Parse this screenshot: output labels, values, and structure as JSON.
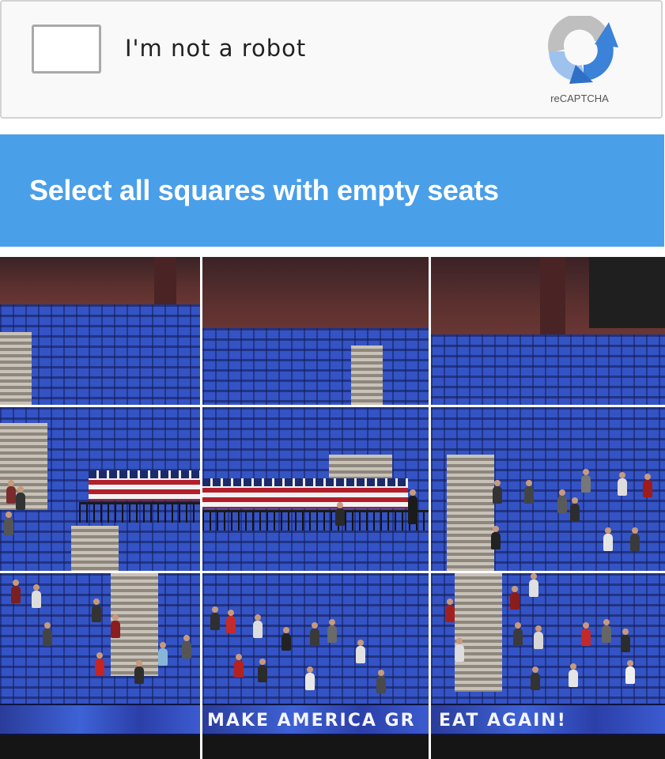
{
  "widget": {
    "checkbox_label": "I'm not a robot",
    "brand": "reCAPTCHA",
    "logo_icon": "recaptcha-arrows-icon",
    "checked": false
  },
  "challenge": {
    "prompt": "Select all squares with empty seats",
    "header_color": "#4a9fe9"
  },
  "grid": {
    "rows": 3,
    "columns": 3,
    "banner_text": [
      "MAKE AMERICA GR",
      "EAT AGAIN!"
    ]
  }
}
